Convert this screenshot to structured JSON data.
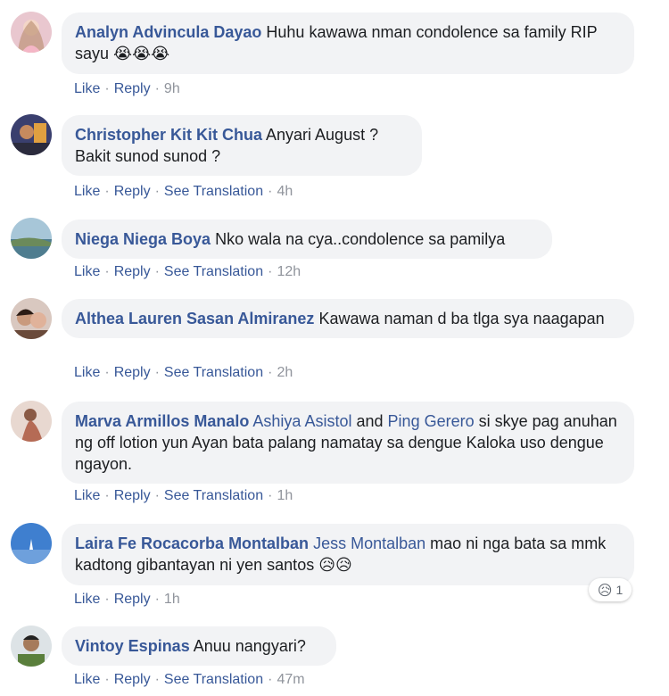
{
  "comments": [
    {
      "author": "Analyn Advincula Dayao",
      "text": "Huhu kawawa nman condolence sa family RIP sayu",
      "emoji": "😭😭😭",
      "actions": {
        "like": "Like",
        "reply": "Reply",
        "time": "9h"
      }
    },
    {
      "author": "Christopher Kit Kit Chua",
      "text": "Anyari August ? Bakit sunod sunod ?",
      "actions": {
        "like": "Like",
        "reply": "Reply",
        "translate": "See Translation",
        "time": "4h"
      }
    },
    {
      "author": "Niega Niega Boya",
      "text": "Nko wala na cya..condolence sa pamilya",
      "actions": {
        "like": "Like",
        "reply": "Reply",
        "translate": "See Translation",
        "time": "12h"
      }
    },
    {
      "author": "Althea Lauren Sasan Almiranez",
      "text": "Kawawa naman d ba tlga sya naagapan",
      "actions": {
        "like": "Like",
        "reply": "Reply",
        "translate": "See Translation",
        "time": "2h"
      }
    },
    {
      "author": "Marva Armillos Manalo",
      "mention1": "Ashiya Asistol",
      "and_text": "and",
      "mention2": "Ping Gerero",
      "text": "si skye pag anuhan ng off lotion yun Ayan bata palang namatay sa dengue Kaloka uso dengue ngayon.",
      "actions": {
        "like": "Like",
        "reply": "Reply",
        "translate": "See Translation",
        "time": "1h"
      }
    },
    {
      "author": "Laira Fe Rocacorba Montalban",
      "mention1": "Jess Montalban",
      "text": "mao ni nga bata sa mmk kadtong gibantayan ni yen santos",
      "emoji": "😥😥",
      "reaction": {
        "emoji": "😥",
        "count": "1"
      },
      "actions": {
        "like": "Like",
        "reply": "Reply",
        "time": "1h"
      }
    },
    {
      "author": "Vintoy Espinas",
      "text": "Anuu nangyari?",
      "actions": {
        "like": "Like",
        "reply": "Reply",
        "translate": "See Translation",
        "time": "47m"
      }
    }
  ],
  "colors": {
    "link": "#385898",
    "bubble": "#f2f3f5",
    "meta": "#90949c"
  }
}
